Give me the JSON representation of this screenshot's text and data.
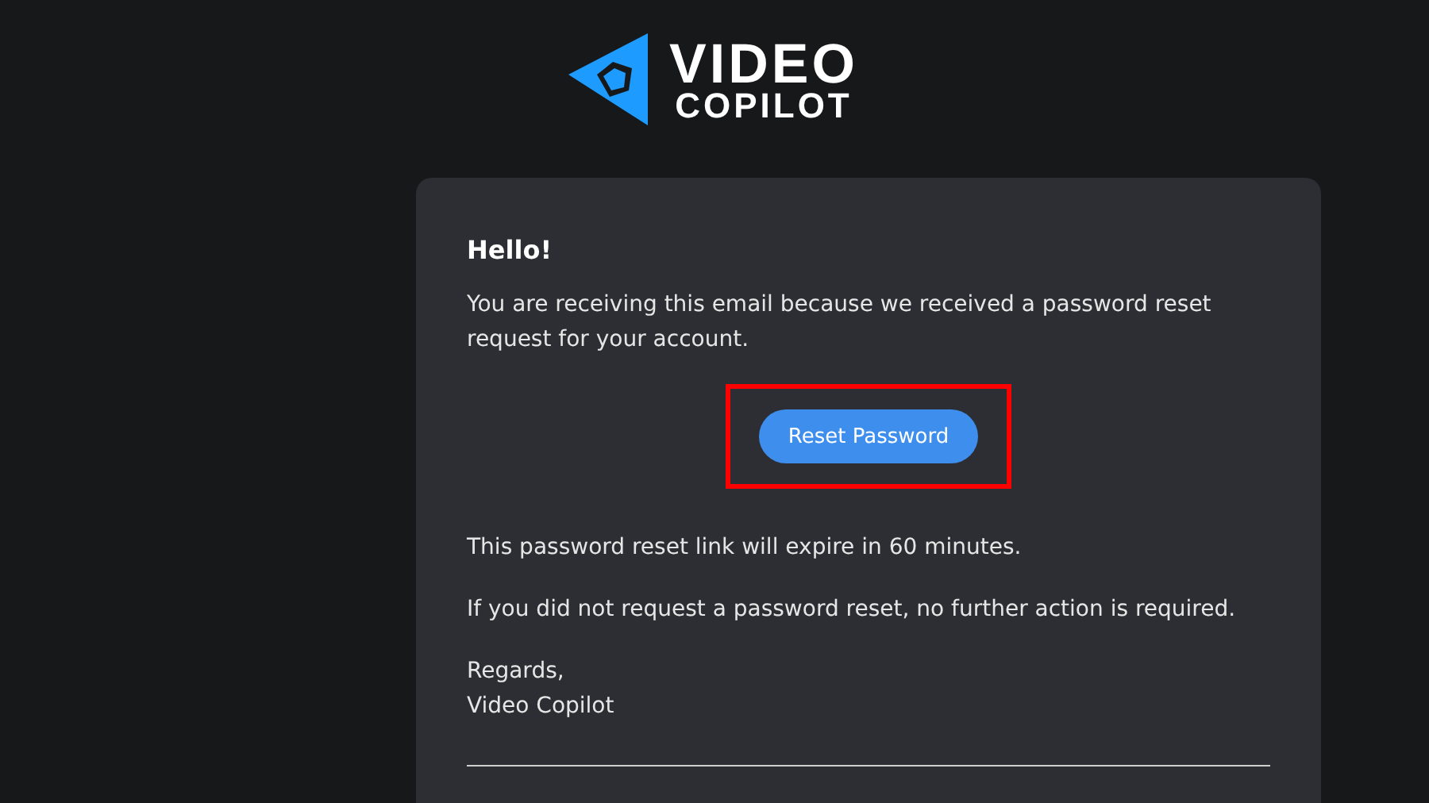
{
  "logo": {
    "line_1": "VIDEO",
    "line_2": "COPILOT"
  },
  "email": {
    "greeting": "Hello!",
    "intro": "You are receiving this email because we received a password reset request for your account.",
    "button": {
      "label": "Reset Password",
      "highlighted": true
    },
    "paragraphs": [
      "This password reset link will expire in 60 minutes.",
      "If you did not request a password reset, no further action is required."
    ],
    "closing": "Regards,",
    "signature": "Video Copilot"
  }
}
